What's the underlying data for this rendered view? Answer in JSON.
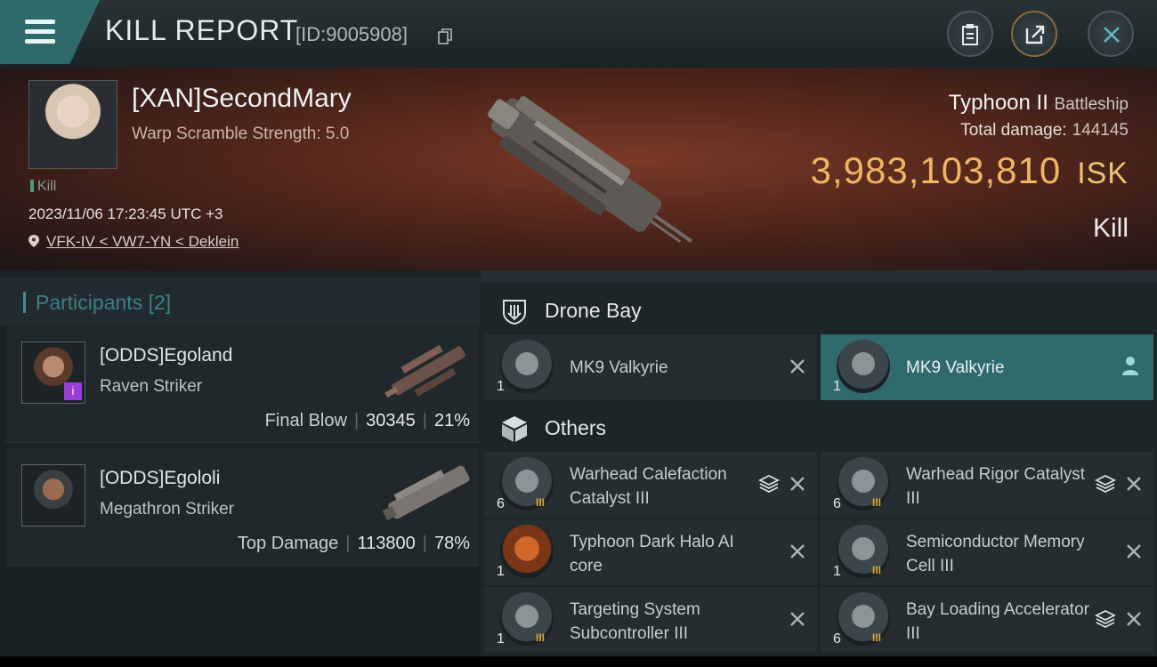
{
  "header": {
    "title": "KILL REPORT",
    "report_id": "[ID:9005908]",
    "icons": [
      "menu-icon",
      "clipboard-icon",
      "share-icon",
      "close-icon"
    ]
  },
  "victim": {
    "name": "[XAN]SecondMary",
    "warp": "Warp Scramble Strength: 5.0",
    "kill_tag": "Kill",
    "datetime": "2023/11/06 17:23:45 UTC +3",
    "location": "VFK-IV < VW7-YN < Deklein",
    "ship": "Typhoon II",
    "ship_class": "Battleship",
    "total_damage_label": "Total damage:",
    "total_damage": "144145",
    "isk_value": "3,983,103,810",
    "isk_unit": "ISK",
    "result": "Kill"
  },
  "participants": {
    "label": "Participants",
    "count": "[2]",
    "rows": [
      {
        "name": "[ODDS]Egoland",
        "ship": "Raven Striker",
        "stat_label": "Final Blow",
        "damage": "30345",
        "percent": "21%",
        "badge": "i"
      },
      {
        "name": "[ODDS]Egololi",
        "ship": "Megathron Striker",
        "stat_label": "Top Damage",
        "damage": "113800",
        "percent": "78%"
      }
    ]
  },
  "drone_bay": {
    "label": "Drone Bay",
    "items": [
      {
        "qty": "1",
        "name": "MK9  Valkyrie"
      },
      {
        "qty": "1",
        "name": "MK9  Valkyrie"
      }
    ]
  },
  "others": {
    "label": "Others",
    "items": [
      {
        "qty": "6",
        "name": "Warhead Calefaction Catalyst III"
      },
      {
        "qty": "6",
        "name": "Warhead Rigor Catalyst III"
      },
      {
        "qty": "1",
        "name": "Typhoon Dark Halo AI core"
      },
      {
        "qty": "1",
        "name": "Semiconductor Memory Cell III"
      },
      {
        "qty": "1",
        "name": "Targeting System Subcontroller III"
      },
      {
        "qty": "6",
        "name": "Bay Loading Accelerator III"
      }
    ]
  },
  "colors": {
    "accent": "#2f6a6d",
    "isk": "#f0b562"
  }
}
